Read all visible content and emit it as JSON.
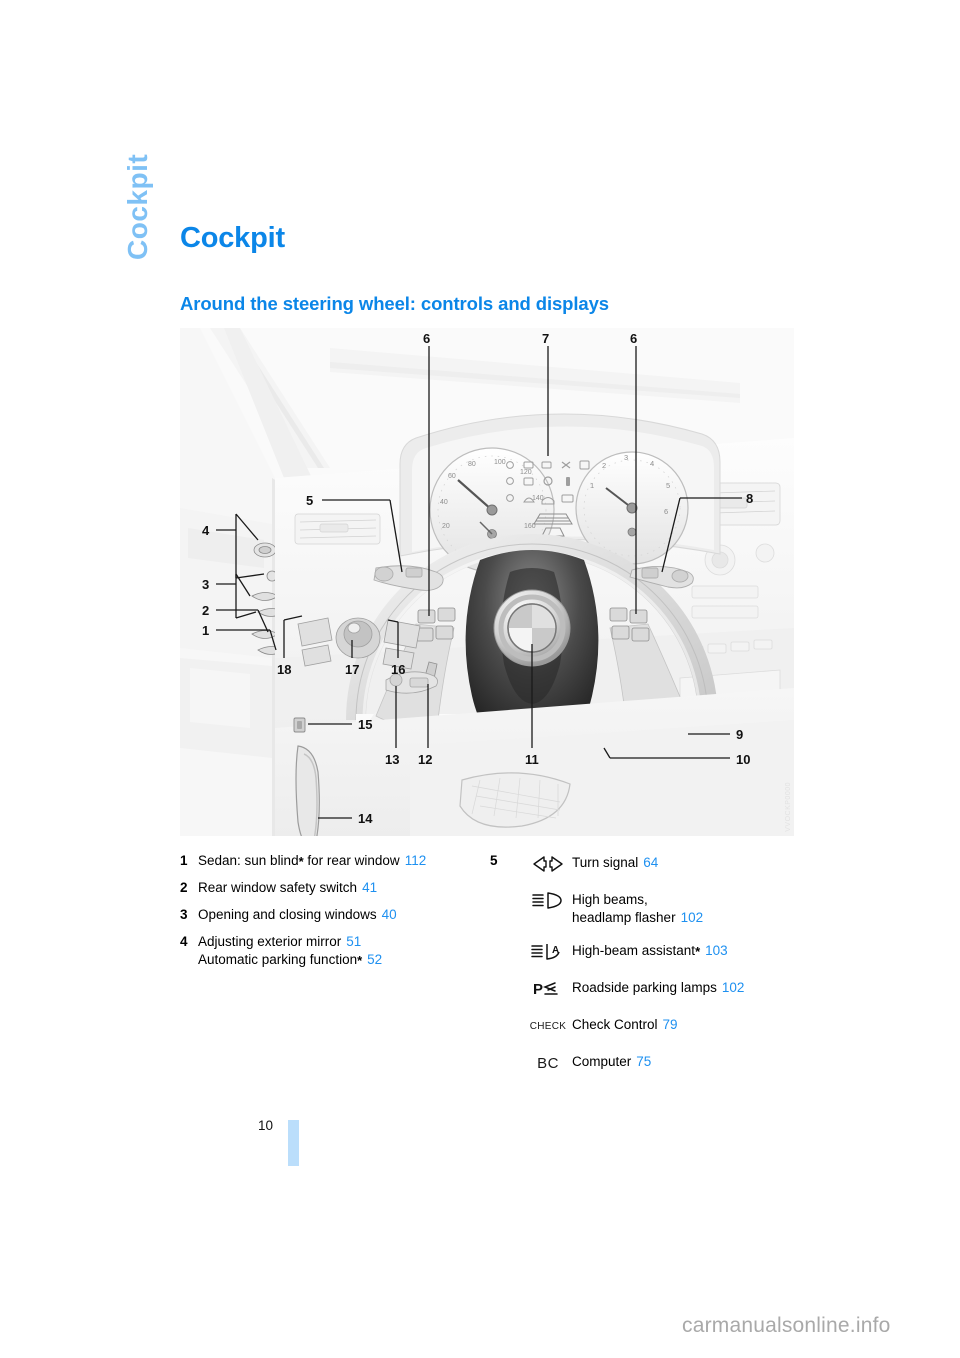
{
  "chapter_tab": "Cockpit",
  "page_title": "Cockpit",
  "section_title": "Around the steering wheel: controls and displays",
  "figure": {
    "caption_code": "VVOCKP0000",
    "callouts": [
      "1",
      "2",
      "3",
      "4",
      "5",
      "6",
      "7",
      "8",
      "9",
      "10",
      "11",
      "12",
      "13",
      "14",
      "15",
      "16",
      "17",
      "18"
    ]
  },
  "legend_left": [
    {
      "num": "1",
      "lines": [
        {
          "text": "Sedan: sun blind",
          "asterisk": "*",
          "text_after": " for rear window",
          "page": "112"
        }
      ]
    },
    {
      "num": "2",
      "lines": [
        {
          "text": "Rear window safety switch",
          "asterisk": "",
          "text_after": "",
          "page": "41"
        }
      ]
    },
    {
      "num": "3",
      "lines": [
        {
          "text": "Opening and closing windows",
          "asterisk": "",
          "text_after": "",
          "page": "40"
        }
      ]
    },
    {
      "num": "4",
      "lines": [
        {
          "text": "Adjusting exterior mirror",
          "asterisk": "",
          "text_after": "",
          "page": "51"
        },
        {
          "text": "Automatic parking function",
          "asterisk": "*",
          "text_after": "",
          "page": "52"
        }
      ]
    }
  ],
  "legend_right": {
    "num": "5",
    "items": [
      {
        "icon": "turn-signal-icon",
        "label": "Turn signal",
        "label2": "",
        "asterisk": "",
        "page": "64"
      },
      {
        "icon": "high-beams-icon",
        "label": "High beams,",
        "label2": "headlamp flasher",
        "asterisk": "",
        "page": "102"
      },
      {
        "icon": "high-beam-assistant-icon",
        "label": "High-beam assistant",
        "label2": "",
        "asterisk": "*",
        "page": "103"
      },
      {
        "icon": "roadside-parking-lamps-icon",
        "label": "Roadside parking lamps",
        "label2": "",
        "asterisk": "",
        "page": "102"
      },
      {
        "icon": "check-control-icon",
        "glyph_text": "CHECK",
        "label": "Check Control",
        "label2": "",
        "asterisk": "",
        "page": "79"
      },
      {
        "icon": "computer-bc-icon",
        "glyph_text": "BC",
        "label": "Computer",
        "label2": "",
        "asterisk": "",
        "page": "75"
      }
    ]
  },
  "folio": "10",
  "watermark": "carmanualsonline.info",
  "colors": {
    "heading_blue": "#0B86E8",
    "tab_blue": "#7FC1F5",
    "page_ref_blue": "#1E90F0",
    "folio_bar_blue": "#BBDEFB"
  }
}
